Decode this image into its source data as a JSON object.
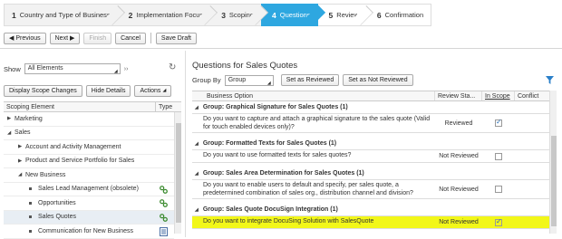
{
  "wizard": {
    "steps": [
      {
        "num": "1",
        "label": "Country and Type of Business",
        "state": "done"
      },
      {
        "num": "2",
        "label": "Implementation Focus",
        "state": "done"
      },
      {
        "num": "3",
        "label": "Scoping",
        "state": "done"
      },
      {
        "num": "4",
        "label": "Questions",
        "state": "active"
      },
      {
        "num": "5",
        "label": "Review",
        "state": "future"
      },
      {
        "num": "6",
        "label": "Confirmation",
        "state": "future"
      }
    ]
  },
  "toolbar": {
    "previous": "Previous",
    "next": "Next",
    "finish": "Finish",
    "cancel": "Cancel",
    "save_draft": "Save Draft"
  },
  "left": {
    "show_label": "Show",
    "show_value": "All Elements",
    "display_scope_changes": "Display Scope Changes",
    "hide_details": "Hide Details",
    "actions": "Actions",
    "col_element": "Scoping Element",
    "col_type": "Type",
    "tree": [
      {
        "label": "Marketing",
        "level": 0,
        "kind": "collapsed"
      },
      {
        "label": "Sales",
        "level": 0,
        "kind": "expanded"
      },
      {
        "label": "Account and Activity Management",
        "level": 1,
        "kind": "collapsed"
      },
      {
        "label": "Product and Service Portfolio for Sales",
        "level": 1,
        "kind": "collapsed"
      },
      {
        "label": "New Business",
        "level": 1,
        "kind": "expanded"
      },
      {
        "label": "Sales Lead Management (obsolete)",
        "level": 2,
        "kind": "leaf",
        "icon": "link"
      },
      {
        "label": "Opportunities",
        "level": 2,
        "kind": "leaf",
        "icon": "link"
      },
      {
        "label": "Sales Quotes",
        "level": 2,
        "kind": "leaf",
        "icon": "link",
        "selected": true
      },
      {
        "label": "Communication for New Business",
        "level": 2,
        "kind": "leaf",
        "icon": "doc"
      }
    ]
  },
  "right": {
    "title": "Questions for Sales Quotes",
    "group_by_label": "Group By",
    "group_by_value": "Group",
    "set_reviewed": "Set as Reviewed",
    "set_not_reviewed": "Set as Not Reviewed",
    "cols": {
      "option": "Business Option",
      "review": "Review Sta...",
      "scope": "In Scope",
      "conflict": "Conflict"
    },
    "groups": [
      {
        "title": "Group: Graphical Signature for Sales Quotes (1)",
        "question": "Do you want to capture and attach a graphical signature to the sales quote (Valid for touch enabled devices only)?",
        "review": "Reviewed",
        "in_scope": true,
        "highlight": false
      },
      {
        "title": "Group: Formatted Texts for Sales Quotes (1)",
        "question": "Do you want to use formatted texts for sales quotes?",
        "review": "Not Reviewed",
        "in_scope": false,
        "highlight": false
      },
      {
        "title": "Group: Sales Area Determination for Sales Quotes (1)",
        "question": "Do you want to enable users to default and specify, per sales quote, a predetermined combination of sales org., distribution channel and division?",
        "review": "Not Reviewed",
        "in_scope": false,
        "highlight": false
      },
      {
        "title": "Group: Sales Quote DocuSign Integration (1)",
        "question": "Do you want to integrate DocuSing Solution with SalesQuote",
        "review": "Not Reviewed",
        "in_scope": true,
        "highlight": true
      }
    ]
  },
  "colors": {
    "active_step": "#2ea7e0",
    "highlight": "#f2f719",
    "icon_green": "#3a8a2e"
  }
}
